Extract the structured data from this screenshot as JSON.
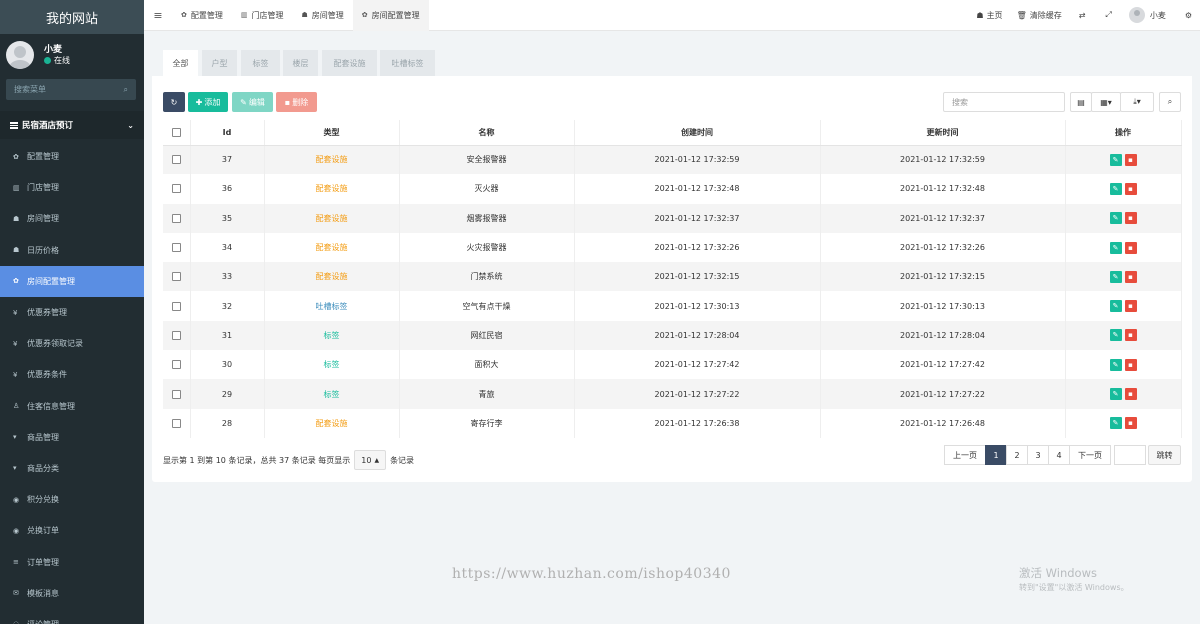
{
  "sidebar": {
    "logo": "我的网站",
    "user": {
      "name": "小麦",
      "status": "在线"
    },
    "search_placeholder": "搜索菜单",
    "group": "民宿酒店预订",
    "items": [
      {
        "icon": "gear-icon",
        "glyph": "✿",
        "label": "配置管理"
      },
      {
        "icon": "bank-icon",
        "glyph": "▥",
        "label": "门店管理"
      },
      {
        "icon": "home-icon",
        "glyph": "☗",
        "label": "房间管理"
      },
      {
        "icon": "home-icon",
        "glyph": "☗",
        "label": "日历价格"
      },
      {
        "icon": "gear-icon",
        "glyph": "✿",
        "label": "房间配置管理",
        "active": true
      },
      {
        "icon": "yen-icon",
        "glyph": "¥",
        "label": "优惠券管理"
      },
      {
        "icon": "yen-icon",
        "glyph": "¥",
        "label": "优惠券领取记录"
      },
      {
        "icon": "yen-icon",
        "glyph": "¥",
        "label": "优惠券条件"
      },
      {
        "icon": "user-icon",
        "glyph": "♙",
        "label": "住客信息管理"
      },
      {
        "icon": "cart-icon",
        "glyph": "▾",
        "label": "商品管理"
      },
      {
        "icon": "cart-icon",
        "glyph": "▾",
        "label": "商品分类"
      },
      {
        "icon": "circle-icon",
        "glyph": "◉",
        "label": "积分兑换"
      },
      {
        "icon": "circle-icon",
        "glyph": "◉",
        "label": "兑换订单"
      },
      {
        "icon": "list-icon",
        "glyph": "≡",
        "label": "订单管理"
      },
      {
        "icon": "envelope-icon",
        "glyph": "✉",
        "label": "模板消息"
      },
      {
        "icon": "comment-icon",
        "glyph": "◌",
        "label": "评论管理"
      }
    ]
  },
  "topbar": {
    "tabs": [
      {
        "glyph": "✿",
        "label": "配置管理"
      },
      {
        "glyph": "▥",
        "label": "门店管理"
      },
      {
        "glyph": "☗",
        "label": "房间管理"
      },
      {
        "glyph": "✿",
        "label": "房间配置管理",
        "active": true
      }
    ],
    "home": "主页",
    "clear_cache": "清除缓存",
    "username": "小麦"
  },
  "subtabs": [
    "全部",
    "户型",
    "标签",
    "楼层",
    "配套设施",
    "吐槽标签"
  ],
  "toolbar": {
    "add": "添加",
    "edit": "编辑",
    "delete": "删除",
    "search_placeholder": "搜索"
  },
  "table": {
    "columns": [
      "Id",
      "类型",
      "名称",
      "创建时间",
      "更新时间",
      "操作"
    ],
    "rows": [
      {
        "id": "37",
        "type": "配套设施",
        "type_color": "#f39c12",
        "name": "安全报警器",
        "created": "2021-01-12 17:32:59",
        "updated": "2021-01-12 17:32:59"
      },
      {
        "id": "36",
        "type": "配套设施",
        "type_color": "#f39c12",
        "name": "灭火器",
        "created": "2021-01-12 17:32:48",
        "updated": "2021-01-12 17:32:48"
      },
      {
        "id": "35",
        "type": "配套设施",
        "type_color": "#f39c12",
        "name": "烟雾报警器",
        "created": "2021-01-12 17:32:37",
        "updated": "2021-01-12 17:32:37"
      },
      {
        "id": "34",
        "type": "配套设施",
        "type_color": "#f39c12",
        "name": "火灾报警器",
        "created": "2021-01-12 17:32:26",
        "updated": "2021-01-12 17:32:26"
      },
      {
        "id": "33",
        "type": "配套设施",
        "type_color": "#f39c12",
        "name": "门禁系统",
        "created": "2021-01-12 17:32:15",
        "updated": "2021-01-12 17:32:15"
      },
      {
        "id": "32",
        "type": "吐槽标签",
        "type_color": "#3c8dbc",
        "name": "空气有点干燥",
        "created": "2021-01-12 17:30:13",
        "updated": "2021-01-12 17:30:13"
      },
      {
        "id": "31",
        "type": "标签",
        "type_color": "#18bc9c",
        "name": "网红民宿",
        "created": "2021-01-12 17:28:04",
        "updated": "2021-01-12 17:28:04"
      },
      {
        "id": "30",
        "type": "标签",
        "type_color": "#18bc9c",
        "name": "面积大",
        "created": "2021-01-12 17:27:42",
        "updated": "2021-01-12 17:27:42"
      },
      {
        "id": "29",
        "type": "标签",
        "type_color": "#18bc9c",
        "name": "青旅",
        "created": "2021-01-12 17:27:22",
        "updated": "2021-01-12 17:27:22"
      },
      {
        "id": "28",
        "type": "配套设施",
        "type_color": "#f39c12",
        "name": "寄存行李",
        "created": "2021-01-12 17:26:38",
        "updated": "2021-01-12 17:26:48"
      }
    ]
  },
  "footer": {
    "info_prefix": "显示第 1 到第 10 条记录，总共 37 条记录 每页显示",
    "page_size": "10",
    "info_suffix": "条记录",
    "prev": "上一页",
    "pages": [
      "1",
      "2",
      "3",
      "4"
    ],
    "current_page": "1",
    "next": "下一页",
    "jump": "跳转"
  },
  "watermark": {
    "url": "https://www.huzhan.com/ishop40340",
    "activate_title": "激活 Windows",
    "activate_sub": "转到\"设置\"以激活 Windows。"
  }
}
